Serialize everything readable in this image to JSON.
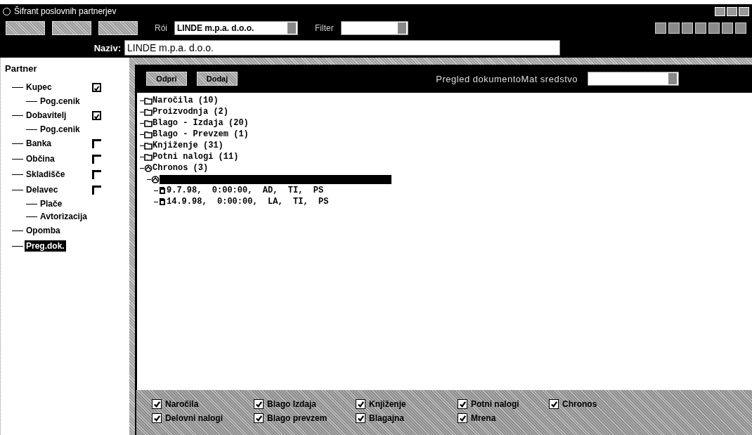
{
  "window": {
    "title": "Šifrant poslovnih partnerjev"
  },
  "toolbar": {
    "combo_label": "Rói",
    "combo_value": "LINDE m.p.a. d.o.o.",
    "filter_label": "Filter"
  },
  "name_field": {
    "label": "Naziv:",
    "value": "LINDE m.p.a. d.o.o."
  },
  "sidebar": {
    "title": "Partner",
    "items": [
      {
        "label": "Kupec",
        "checked": true,
        "selected": false,
        "children": [
          {
            "label": "Pog.cenik",
            "selected": false
          }
        ]
      },
      {
        "label": "Dobavitelj",
        "checked": true,
        "selected": false,
        "children": [
          {
            "label": "Pog.cenik",
            "selected": false
          }
        ]
      },
      {
        "label": "Banka",
        "checked": false,
        "selected": false
      },
      {
        "label": "Občina",
        "checked": false,
        "selected": false
      },
      {
        "label": "Skladišče",
        "checked": false,
        "selected": false
      },
      {
        "label": "Delavec",
        "checked": false,
        "selected": false,
        "children": [
          {
            "label": "Plače",
            "selected": false
          },
          {
            "label": "Avtorizacija",
            "selected": false
          }
        ]
      },
      {
        "label": "Opomba",
        "selected": false
      },
      {
        "label": "Preg.dok.",
        "selected": true
      }
    ]
  },
  "panel": {
    "buttons": [
      "Odpri",
      "Dodaj"
    ],
    "title": "Pregled dokumento",
    "mat_label": "Mat sredstvo",
    "tree": [
      {
        "kind": "folder",
        "label": "Naročila (10)",
        "expanded": false,
        "selected": false
      },
      {
        "kind": "folder",
        "label": "Proizvodnja (2)",
        "expanded": false,
        "selected": false
      },
      {
        "kind": "folder",
        "label": "Blago - Izdaja (20)",
        "expanded": false,
        "selected": false
      },
      {
        "kind": "folder",
        "label": "Blago - Prevzem (1)",
        "expanded": false,
        "selected": false
      },
      {
        "kind": "folder",
        "label": "Knjiženje (31)",
        "expanded": false,
        "selected": false
      },
      {
        "kind": "folder",
        "label": "Potni nalogi (11)",
        "expanded": false,
        "selected": false
      },
      {
        "kind": "folder",
        "label": "Chronos (3)",
        "expanded": true,
        "selected": false,
        "children": [
          {
            "kind": "folder",
            "expanded": true,
            "selected": true,
            "children": [
              {
                "kind": "document",
                "label": "9.7.98,  0:00:00,  AD,  TI,  PS",
                "selected": false
              },
              {
                "kind": "document",
                "label": "14.9.98,  0:00:00,  LA,  TI,  PS",
                "selected": false
              }
            ]
          }
        ]
      }
    ],
    "filters": [
      {
        "label": "Naročila",
        "checked": true
      },
      {
        "label": "Blago Izdaja",
        "checked": true
      },
      {
        "label": "Knjiženje",
        "checked": true
      },
      {
        "label": "Potni nalogi",
        "checked": true
      },
      {
        "label": "Chronos",
        "checked": true
      },
      {
        "label": "Delovni nalogi",
        "checked": true
      },
      {
        "label": "Blago prevzem",
        "checked": true
      },
      {
        "label": "Blagajna",
        "checked": true
      },
      {
        "label": "Mrena",
        "checked": true
      }
    ]
  }
}
